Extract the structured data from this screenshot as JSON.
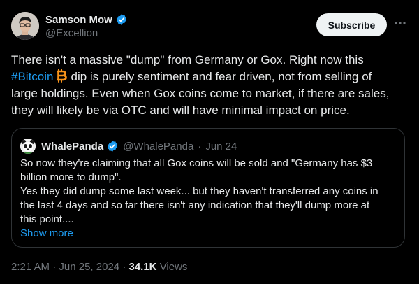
{
  "author": {
    "name": "Samson Mow",
    "handle": "@Excellion",
    "verified_color": "#1d9bf0"
  },
  "actions": {
    "subscribe_label": "Subscribe",
    "more_icon": "ellipsis-icon"
  },
  "tweet": {
    "lines": [
      "There isn't a massive \"dump\" from Germany or Gox. Right now this",
      "dip is purely sentiment and fear driven, not from selling of",
      "large holdings. Even when Gox coins come to market, if there are sales,",
      "they will likely be via OTC and will have minimal impact on price."
    ],
    "hashtag": "#Bitcoin",
    "hashtag_icon": "bitcoin-icon",
    "hashtag_color": "#1d9bf0",
    "bitcoin_color": "#f7931a"
  },
  "quote": {
    "name": "WhalePanda",
    "handle": "@WhalePanda",
    "separator": "·",
    "date": "Jun 24",
    "lines": [
      "So now they're claiming that all Gox coins will be sold and \"Germany has $3",
      "billion more to dump\".",
      "Yes they did dump some last week... but they haven't transferred any coins in",
      "the last 4 days and so far there isn't any indication that they'll dump more at",
      "this point...."
    ],
    "show_more": "Show more"
  },
  "meta": {
    "time": "2:21 AM",
    "separator1": "·",
    "date": "Jun 25, 2024",
    "separator2": "·",
    "views_count": "34.1K",
    "views_label": "Views"
  },
  "colors": {
    "background": "#000000",
    "text": "#e7e9ea",
    "secondary": "#71767b",
    "accent": "#1d9bf0",
    "border": "#2f3336"
  }
}
